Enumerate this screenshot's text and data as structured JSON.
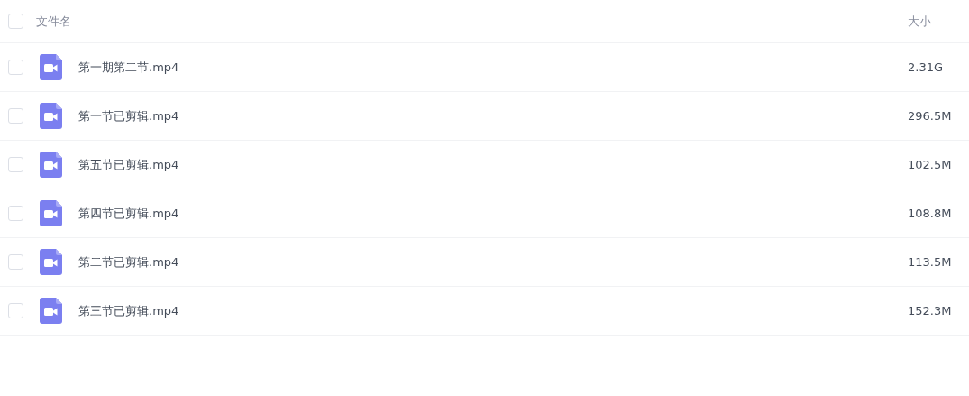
{
  "header": {
    "checked": false,
    "name": "文件名",
    "size": "大小"
  },
  "files": [
    {
      "checked": false,
      "kind": "video",
      "name": "第一期第二节.mp4",
      "size": "2.31G"
    },
    {
      "checked": false,
      "kind": "video",
      "name": "第一节已剪辑.mp4",
      "size": "296.5M"
    },
    {
      "checked": false,
      "kind": "video",
      "name": "第五节已剪辑.mp4",
      "size": "102.5M"
    },
    {
      "checked": false,
      "kind": "video",
      "name": "第四节已剪辑.mp4",
      "size": "108.8M"
    },
    {
      "checked": false,
      "kind": "video",
      "name": "第二节已剪辑.mp4",
      "size": "113.5M"
    },
    {
      "checked": false,
      "kind": "video",
      "name": "第三节已剪辑.mp4",
      "size": "152.3M"
    }
  ]
}
